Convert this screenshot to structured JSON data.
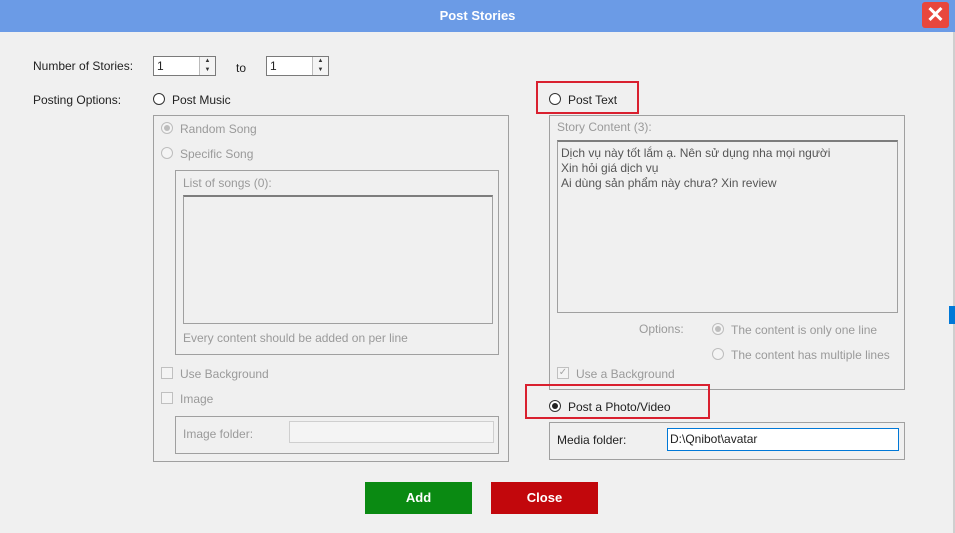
{
  "window": {
    "title": "Post Stories",
    "close_glyph": "✕"
  },
  "stories": {
    "label": "Number of Stories:",
    "from": "1",
    "to_label": "to",
    "to": "1"
  },
  "posting": {
    "label": "Posting Options:",
    "music": {
      "label": "Post Music",
      "random": "Random Song",
      "specific": "Specific Song",
      "list_label": "List of songs (0):",
      "hint": "Every content should be added on per line",
      "use_background": "Use Background",
      "image": "Image",
      "image_folder_label": "Image folder:",
      "image_folder_value": ""
    },
    "text": {
      "label": "Post Text",
      "content_label": "Story Content (3):",
      "lines": [
        "Dịch vụ này tốt lắm ạ. Nên sử dụng nha mọi người",
        "Xin hỏi giá dịch vụ",
        "Ai dùng sản phẩm này chưa? Xin review"
      ],
      "options_label": "Options:",
      "opt_one": "The content is only one line",
      "opt_multi": "The content has multiple lines",
      "use_background": "Use a Background"
    },
    "photo": {
      "label": "Post a Photo/Video",
      "media_label": "Media folder:",
      "media_value": "D:\\Qnibot\\avatar"
    }
  },
  "buttons": {
    "add": "Add",
    "close": "Close"
  },
  "colors": {
    "titlebar": "#6b9be6",
    "add": "#0a8a12",
    "close": "#c2070c",
    "highlight": "#d9202f"
  }
}
